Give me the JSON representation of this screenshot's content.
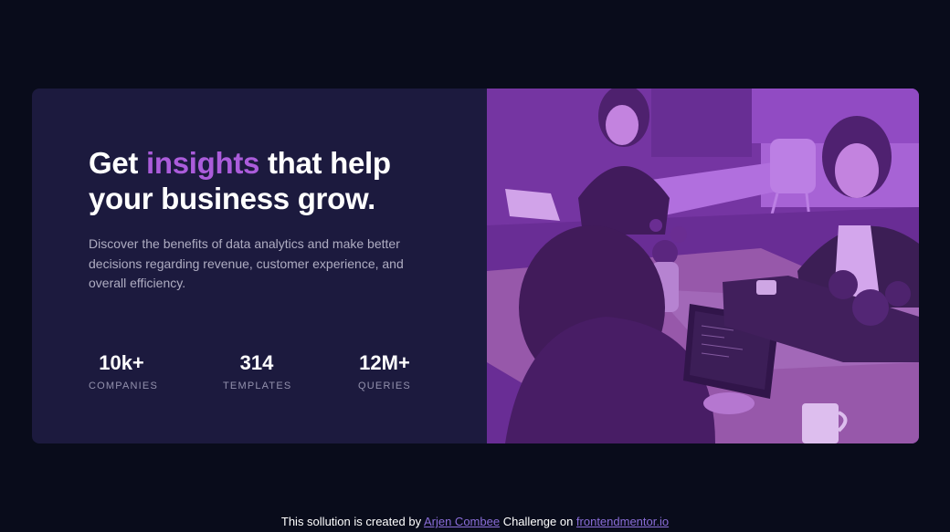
{
  "card": {
    "headline": {
      "before": "Get ",
      "accent": "insights",
      "after": " that help your business grow."
    },
    "description": "Discover the benefits of data analytics and make better decisions regarding revenue, customer experience, and overall efficiency.",
    "stats": [
      {
        "value": "10k+",
        "label": "COMPANIES"
      },
      {
        "value": "314",
        "label": "TEMPLATES"
      },
      {
        "value": "12M+",
        "label": "QUERIES"
      }
    ]
  },
  "attribution": {
    "prefix": "This sollution is created by ",
    "author": "Arjen Combee",
    "middle": " Challenge on ",
    "site": "frontendmentor.io"
  },
  "colors": {
    "page_bg": "#090c1b",
    "card_bg": "#1c1a3e",
    "accent": "#ab5cdb",
    "image_tint": "#aa5cdb"
  }
}
